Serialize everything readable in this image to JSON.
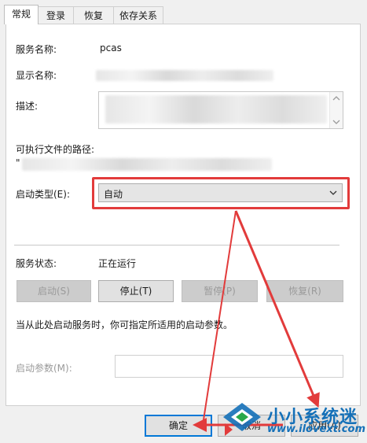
{
  "tabs": [
    {
      "label": "常规"
    },
    {
      "label": "登录"
    },
    {
      "label": "恢复"
    },
    {
      "label": "依存关系"
    }
  ],
  "general": {
    "service_name_label": "服务名称:",
    "service_name_value": "pcas",
    "display_name_label": "显示名称:",
    "description_label": "描述:",
    "exe_path_label": "可执行文件的路径:",
    "exe_path_prefix": "\"",
    "startup_type_label": "启动类型(E):",
    "startup_type_value": "自动",
    "service_status_label": "服务状态:",
    "service_status_value": "正在运行",
    "start_button": "启动(S)",
    "stop_button": "停止(T)",
    "pause_button": "暂停(P)",
    "resume_button": "恢复(R)",
    "hint_text": "当从此处启动服务时，你可指定所适用的启动参数。",
    "start_params_label": "启动参数(M):"
  },
  "footer": {
    "ok_button": "确定",
    "cancel_button": "取消",
    "apply_button": "应用(A)"
  },
  "watermark": {
    "text": "小小系统迷",
    "url": "www.ilovext.com"
  },
  "colors": {
    "highlight_red": "#e23b3b",
    "watermark_blue": "#1470b8",
    "focus_blue": "#0078d7"
  }
}
